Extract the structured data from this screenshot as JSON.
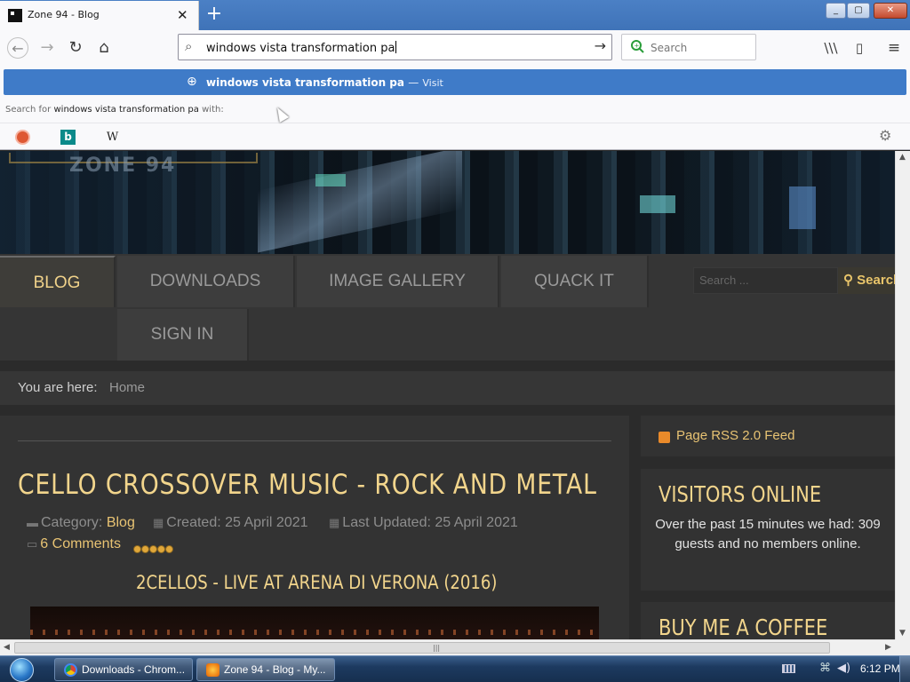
{
  "browser": {
    "tab_title": "Zone 94 - Blog",
    "url_text": "windows vista transformation pa",
    "search_placeholder": "Search",
    "suggestion": {
      "text": "windows vista transformation pa",
      "separator": "—",
      "action": "Visit"
    },
    "search_with": {
      "prefix": "Search for",
      "query": "windows vista transformation pa",
      "suffix": "with:"
    },
    "engines": [
      "DuckDuckGo",
      "Bing",
      "Wikipedia"
    ],
    "icons": {
      "back": "←",
      "forward": "→",
      "reload": "↻",
      "home": "⌂",
      "search": "⌕",
      "go": "→",
      "library": "\\\\\\",
      "sidebar": "▯",
      "menu": "≡",
      "close_tab": "✕",
      "new_tab": "+",
      "globe": "⊕",
      "settings": "⚙",
      "minimize": "_",
      "maximize": "▢",
      "close": "✕",
      "bing": "b",
      "wiki": "W"
    }
  },
  "site": {
    "logo_text": "ZONE 94",
    "menu": {
      "blog": "BLOG",
      "downloads": "DOWNLOADS",
      "gallery": "IMAGE GALLERY",
      "quack": "QUACK IT",
      "signin": "SIGN IN"
    },
    "search_placeholder": "Search ...",
    "search_button": "Search",
    "breadcrumb": {
      "label": "You are here:",
      "home": "Home"
    },
    "article": {
      "title": "CELLO CROSSOVER MUSIC - ROCK AND METAL",
      "category_label": "Category:",
      "category": "Blog",
      "created": "Created: 25 April 2021",
      "updated": "Last Updated: 25 April 2021",
      "comments": "6 Comments",
      "rating": 5,
      "subtitle": "2CELLOS - LIVE AT ARENA DI VERONA (2016)"
    },
    "sidebar": {
      "rss": "Page RSS 2.0 Feed",
      "visitors_title": "VISITORS ONLINE",
      "visitors_text": "Over the past 15 minutes we had: 309 guests and no members online.",
      "coffee_title": "BUY ME A COFFEE"
    },
    "colors": {
      "accent": "#f2d58c",
      "link": "#e8c373",
      "background": "#2b2b2b"
    }
  },
  "taskbar": {
    "items": [
      {
        "label": "Downloads - Chrom..."
      },
      {
        "label": "Zone 94 - Blog - My..."
      }
    ],
    "clock": "6:12 PM"
  }
}
